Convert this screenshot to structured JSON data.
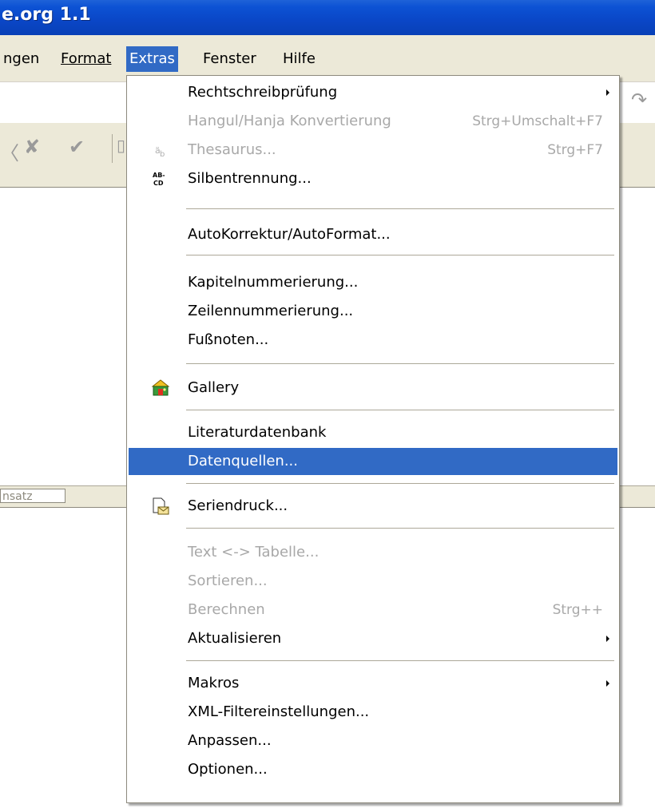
{
  "window": {
    "title": "e.org 1.1"
  },
  "menubar": {
    "items": [
      {
        "label": "ngen"
      },
      {
        "label": "Format",
        "mnemonic": "F"
      },
      {
        "label": "Extras",
        "mnemonic": "x",
        "active": true
      },
      {
        "label": "Fenster",
        "mnemonic": "s"
      },
      {
        "label": "Hilfe",
        "mnemonic": "H"
      }
    ]
  },
  "statusbar": {
    "cell_text": "nsatz"
  },
  "extras_menu": {
    "items": [
      {
        "label": "Rechtschreibprüfung",
        "submenu": true
      },
      {
        "label": "Hangul/Hanja Konvertierung",
        "shortcut": "Strg+Umschalt+F7",
        "disabled": true
      },
      {
        "label": "Thesaurus...",
        "shortcut": "Strg+F7",
        "disabled": true,
        "icon": "thesaurus-icon"
      },
      {
        "label": "Silbentrennung...",
        "icon": "hyphenation-icon"
      },
      {
        "label": "AutoKorrektur/AutoFormat..."
      },
      {
        "label": "Kapitelnummerierung..."
      },
      {
        "label": "Zeilennummerierung..."
      },
      {
        "label": "Fußnoten..."
      },
      {
        "label": "Gallery",
        "icon": "gallery-icon"
      },
      {
        "label": "Literaturdatenbank"
      },
      {
        "label": "Datenquellen...",
        "highlighted": true
      },
      {
        "label": "Seriendruck...",
        "icon": "mail-merge-icon"
      },
      {
        "label": "Text <-> Tabelle...",
        "disabled": true
      },
      {
        "label": "Sortieren...",
        "disabled": true
      },
      {
        "label": "Berechnen",
        "shortcut": "Strg++",
        "disabled": true
      },
      {
        "label": "Aktualisieren",
        "submenu": true
      },
      {
        "label": "Makros",
        "submenu": true
      },
      {
        "label": "XML-Filtereinstellungen..."
      },
      {
        "label": "Anpassen..."
      },
      {
        "label": "Optionen..."
      }
    ],
    "icons": {
      "hyphenation_glyph_top": "AB-",
      "hyphenation_glyph_bottom": "CD"
    }
  },
  "colors": {
    "highlight": "#316ac5",
    "menu_bg": "#ece9d8",
    "titlebar": "#0a46c6",
    "disabled_text": "#a8a8a8"
  }
}
